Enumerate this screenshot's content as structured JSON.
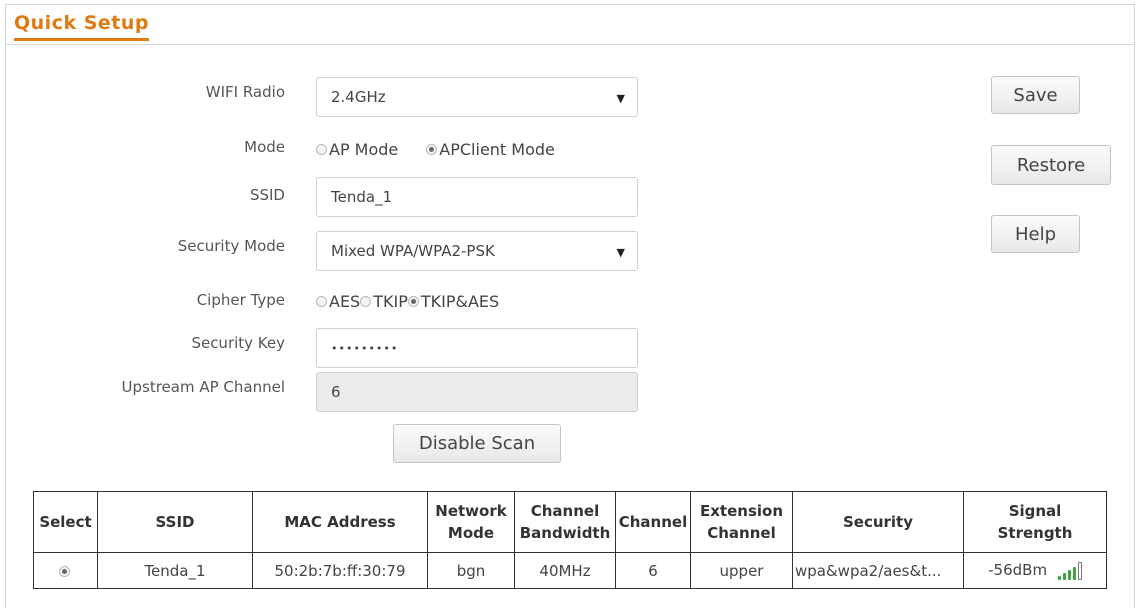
{
  "header": {
    "title": "Quick Setup"
  },
  "form": {
    "wifi_radio": {
      "label": "WIFI Radio",
      "value": "2.4GHz"
    },
    "mode": {
      "label": "Mode",
      "options": [
        "AP Mode",
        "APClient Mode"
      ],
      "selected": "APClient Mode"
    },
    "ssid": {
      "label": "SSID",
      "value": "Tenda_1"
    },
    "security_mode": {
      "label": "Security Mode",
      "value": "Mixed WPA/WPA2-PSK"
    },
    "cipher_type": {
      "label": "Cipher Type",
      "options": [
        "AES",
        "TKIP",
        "TKIP&AES"
      ],
      "selected": "TKIP&AES"
    },
    "security_key": {
      "label": "Security Key",
      "value": "•••••••••"
    },
    "upstream_channel": {
      "label": "Upstream AP Channel",
      "value": "6"
    },
    "disable_scan_label": "Disable Scan"
  },
  "actions": {
    "save": "Save",
    "restore": "Restore",
    "help": "Help"
  },
  "scan_table": {
    "headers": {
      "select": "Select",
      "ssid": "SSID",
      "mac": "MAC Address",
      "network_mode_1": "Network",
      "network_mode_2": "Mode",
      "bandwidth_1": "Channel",
      "bandwidth_2": "Bandwidth",
      "channel": "Channel",
      "extension_1": "Extension",
      "extension_2": "Channel",
      "security": "Security",
      "signal_1": "Signal",
      "signal_2": "Strength"
    },
    "rows": [
      {
        "selected": true,
        "ssid": "Tenda_1",
        "mac": "50:2b:7b:ff:30:79",
        "network_mode": "bgn",
        "bandwidth": "40MHz",
        "channel": "6",
        "extension": "upper",
        "security": "wpa&wpa2/aes&t...",
        "signal": "-56dBm",
        "signal_bars": 4,
        "signal_bars_total": 5
      }
    ]
  },
  "colors": {
    "accent": "#e07a10",
    "signal_green": "#3ea53e"
  }
}
